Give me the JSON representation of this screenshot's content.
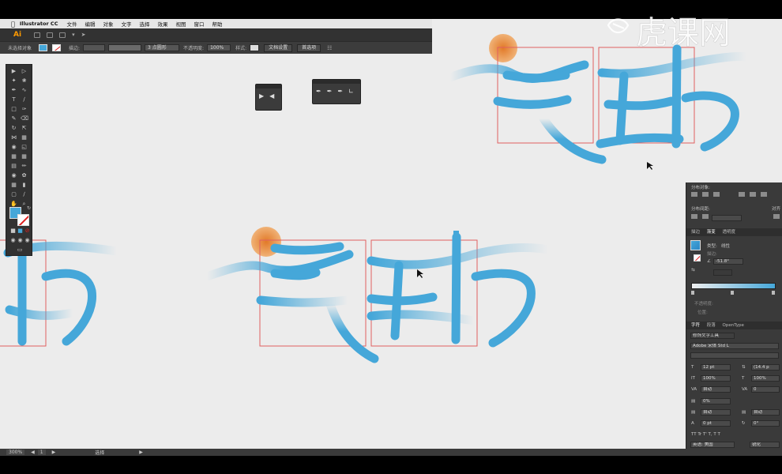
{
  "menubar": {
    "app_name": "Illustrator CC",
    "items": [
      "文件",
      "编辑",
      "对象",
      "文字",
      "选择",
      "效果",
      "视图",
      "窗口",
      "帮助"
    ]
  },
  "appbar": {
    "logo": "Ai"
  },
  "controlbar": {
    "selection_label": "未选择对象",
    "stroke_label": "描边:",
    "brush_value": "3 点圆形",
    "opacity_label": "不透明度:",
    "opacity_value": "100%",
    "style_label": "样式:",
    "doc_setup": "文档设置",
    "preferences": "首选项"
  },
  "watermark": "虎课网",
  "right_panel": {
    "distribute_objects": "分布对象:",
    "distribute_spacing": "分布间距:",
    "align_to": "对齐",
    "tabs_a": [
      "描边",
      "渐变",
      "透明度"
    ],
    "gradient_type_label": "类型:",
    "gradient_type": "线性",
    "stroke_label": "描边:",
    "angle": "-51.8°",
    "aspect_placeholder": "",
    "opacity_label": "不透明度:",
    "position_label": "位置:",
    "tabs_b": [
      "字符",
      "段落",
      "OpenType"
    ],
    "touch_type": "修饰文字工具",
    "font_name": "Adobe 宋体 Std L",
    "font_size": "12 pt",
    "leading": "(14.4 p",
    "vscale": "100%",
    "hscale": "100%",
    "kerning": "自动",
    "tracking": "0",
    "tsume": "0%",
    "aki_left": "自动",
    "aki_right": "自动",
    "baseline": "0 pt",
    "rotation": "0°",
    "language": "英语: 美国",
    "aa": "锐化"
  },
  "statusbar": {
    "zoom": "300%",
    "page": "1",
    "tool": "选择"
  },
  "colors": {
    "accent_blue": "#45a7d9",
    "sun_orange": "#e8913a",
    "guide_red": "#e06060"
  }
}
